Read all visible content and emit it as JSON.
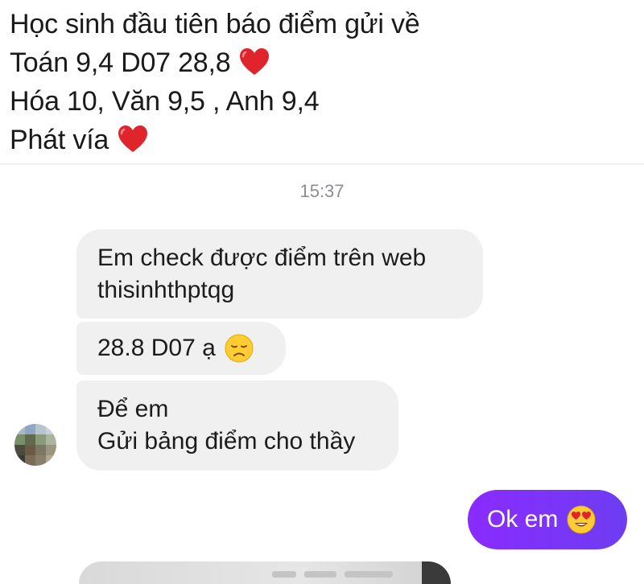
{
  "caption": {
    "lines": [
      "Học sinh đầu tiên báo điểm gửi về",
      "Toán 9,4 D07 28,8",
      "Hóa 10, Văn 9,5 , Anh 9,4",
      "Phát vía"
    ],
    "line1_icon": "",
    "line2_icon": "red-heart",
    "line4_icon": "red-heart"
  },
  "chat": {
    "timestamp": "15:37",
    "received": [
      {
        "lines": [
          "Em check được điểm trên web",
          "thisinhthptqg"
        ]
      },
      {
        "lines": [
          "28.8 D07 ạ"
        ],
        "emoji": "disappointed-face"
      },
      {
        "lines": [
          "Để em",
          "Gửi bảng điểm cho thầy"
        ]
      }
    ],
    "sent": [
      {
        "text": "Ok em",
        "emoji": "heart-eyes-face"
      }
    ]
  },
  "colors": {
    "received_bubble": "#f0f0f0",
    "sent_bubble": "#7c3aed",
    "timestamp": "#8a8d91",
    "heart": "#e0242c"
  }
}
